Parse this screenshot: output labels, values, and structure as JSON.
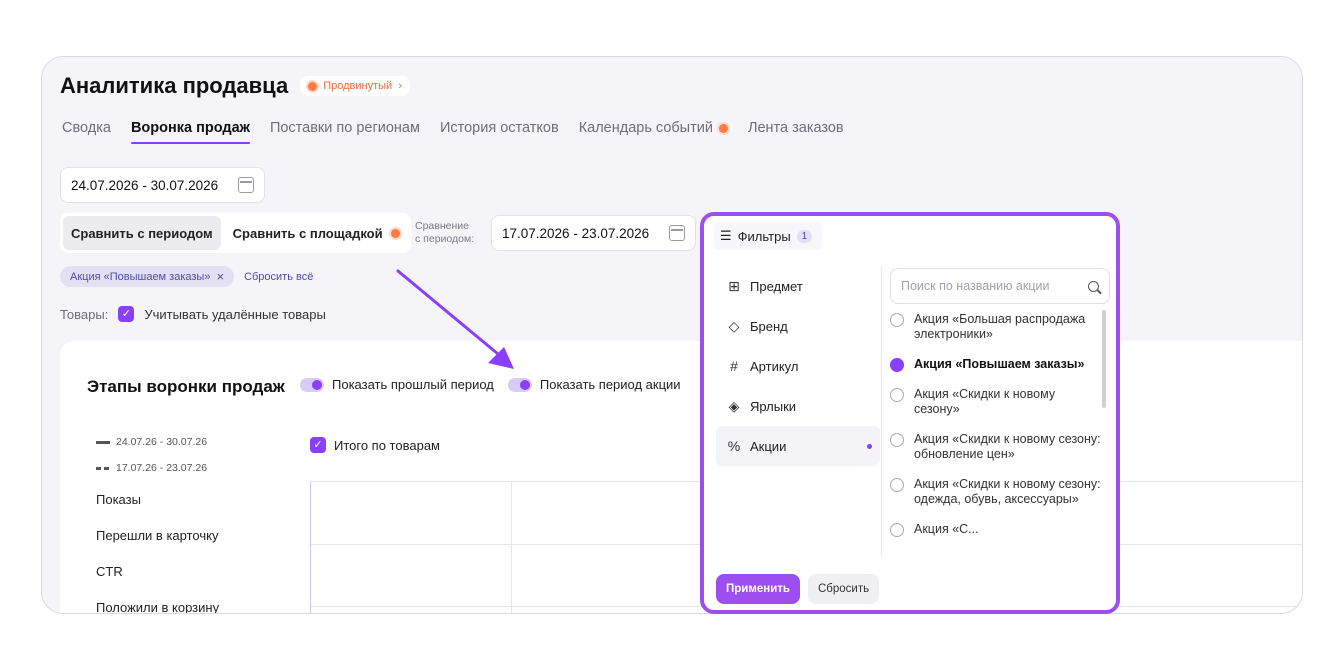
{
  "header": {
    "title": "Аналитика продавца",
    "plan_badge": "Продвинутый"
  },
  "tabs": [
    {
      "label": "Сводка"
    },
    {
      "label": "Воронка продаж",
      "active": true
    },
    {
      "label": "Поставки по регионам"
    },
    {
      "label": "История остатков"
    },
    {
      "label": "Календарь событий",
      "badge": true
    },
    {
      "label": "Лента заказов"
    }
  ],
  "date_range": "24.07.2026 - 30.07.2026",
  "compare": {
    "by_period_label": "Сравнить с периодом",
    "by_platform_label": "Сравнить с площадкой",
    "period_caption_line1": "Сравнение",
    "period_caption_line2": "с периодом:",
    "period_value": "17.07.2026 - 23.07.2026"
  },
  "chips": {
    "active_filter": "Акция «Повышаем заказы»",
    "reset_all": "Сбросить всё"
  },
  "goods": {
    "label": "Товары:",
    "include_deleted": "Учитывать удалённые товары"
  },
  "funnel": {
    "title": "Этапы воронки продаж",
    "toggle_prev": "Показать прошлый период",
    "toggle_promo": "Показать период акции",
    "legend_current": "24.07.26 - 30.07.26",
    "legend_previous": "17.07.26 - 23.07.26",
    "total_label": "Итого по товарам",
    "metrics": [
      "Показы",
      "Перешли в карточку",
      "CTR",
      "Положили в корзину"
    ]
  },
  "filters_popup": {
    "title": "Фильтры",
    "count": "1",
    "categories": [
      "Предмет",
      "Бренд",
      "Артикул",
      "Ярлыки",
      "Акции"
    ],
    "search_placeholder": "Поиск по названию акции",
    "options": [
      "Акция «Большая распродажа электроники»",
      "Акция «Повышаем заказы»",
      "Акция «Скидки к новому сезону»",
      "Акция «Скидки к новому сезону: обновление цен»",
      "Акция «Скидки к новому сезону: одежда, обувь, аксессуары»",
      "Акция «С..."
    ],
    "apply_label": "Применить",
    "reset_label": "Сбросить"
  },
  "colors": {
    "accent": "#8a3ffc",
    "popup_border": "#9d4eef",
    "orange": "#ff7a45"
  }
}
